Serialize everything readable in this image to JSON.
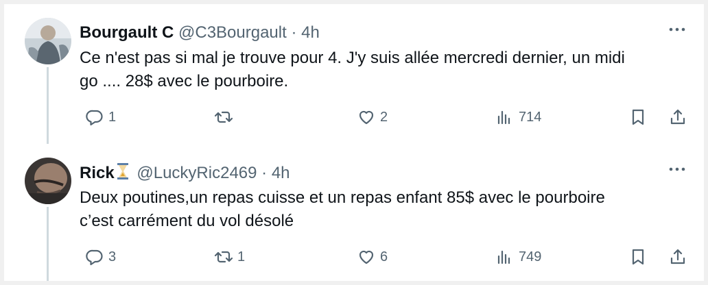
{
  "tweets": [
    {
      "name": "Bourgault C",
      "handle": "@C3Bourgault",
      "time": "· 4h",
      "text_line1": "Ce n'est pas si mal je trouve pour 4. J'y suis allée mercredi dernier, un midi",
      "text_line2": "go .... 28$ avec le pourboire.",
      "replies": "1",
      "retweets": "",
      "likes": "2",
      "views": "714"
    },
    {
      "name": "Rick",
      "handle": "@LuckyRic2469",
      "time": "· 4h",
      "text_line1": "Deux poutines,un repas cuisse et un repas enfant 85$ avec le pourboire",
      "text_line2": "c’est carrément du vol désolé",
      "replies": "3",
      "retweets": "1",
      "likes": "6",
      "views": "749"
    }
  ],
  "icons": {
    "reply": "reply-icon",
    "retweet": "retweet-icon",
    "like": "heart-icon",
    "views": "views-icon",
    "bookmark": "bookmark-icon",
    "share": "share-icon",
    "more": "more-icon",
    "badge": "hourglass-icon"
  },
  "colors": {
    "text": "#0f1419",
    "secondary": "#536471",
    "thread_line": "#cfd9de",
    "background": "#ffffff"
  }
}
